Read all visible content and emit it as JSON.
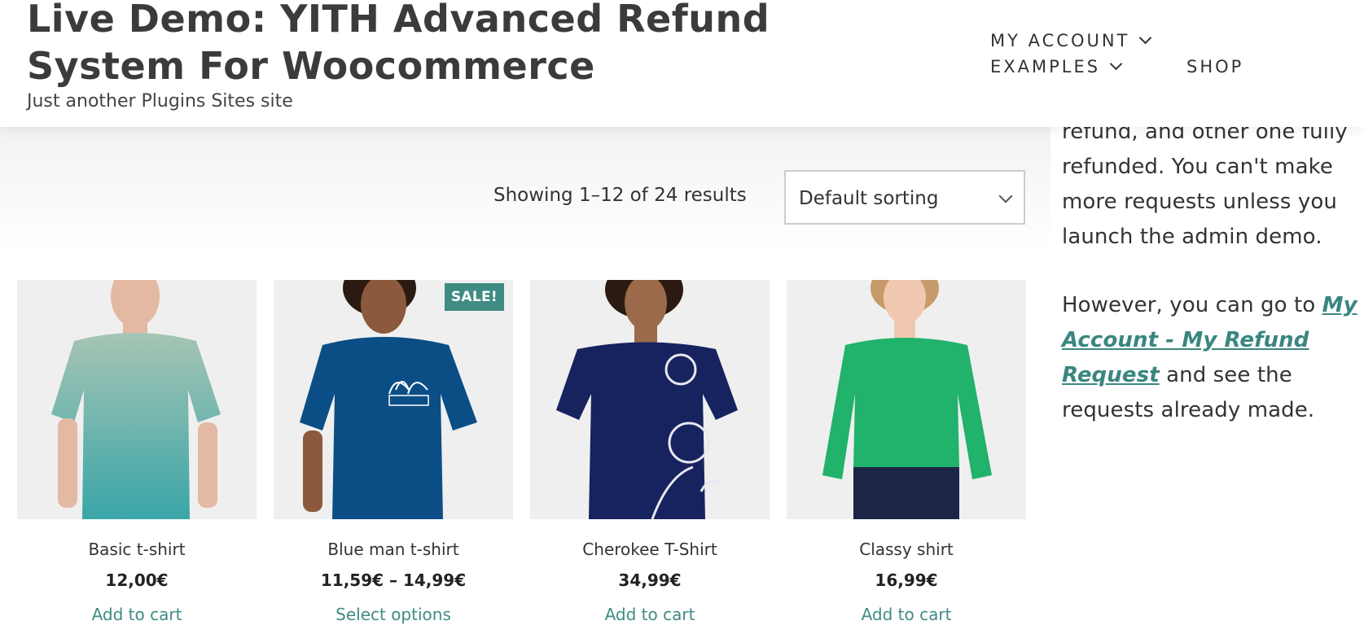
{
  "header": {
    "site_title": "Live Demo: YITH Advanced Refund System For Woocommerce",
    "tagline": "Just another Plugins Sites site",
    "nav": [
      {
        "label": "MY ACCOUNT",
        "has_dropdown": true
      },
      {
        "label": "EXAMPLES",
        "has_dropdown": true
      },
      {
        "label": "SHOP",
        "has_dropdown": false
      }
    ]
  },
  "sidebar": {
    "para1": "refund, and other one fully refunded. You can't make more requests unless you launch the admin demo.",
    "para2_before": "However, you can go to ",
    "para2_link": "My Account - My Refund Request",
    "para2_after": " and see the requests already made."
  },
  "toolbar": {
    "result_count": "Showing 1–12 of 24 results",
    "ordering_selected": "Default sorting"
  },
  "products": [
    {
      "name": "Basic t-shirt",
      "price": "12,00€",
      "button": "Add to cart",
      "sale": false
    },
    {
      "name": "Blue man t-shirt",
      "price": "11,59€ – 14,99€",
      "button": "Select options",
      "sale": true,
      "badge": "SALE!"
    },
    {
      "name": "Cherokee T-Shirt",
      "price": "34,99€",
      "button": "Add to cart",
      "sale": false
    },
    {
      "name": "Classy shirt",
      "price": "16,99€",
      "button": "Add to cart",
      "sale": false
    }
  ],
  "colors": {
    "accent": "#3f8c83",
    "text": "#333333"
  }
}
